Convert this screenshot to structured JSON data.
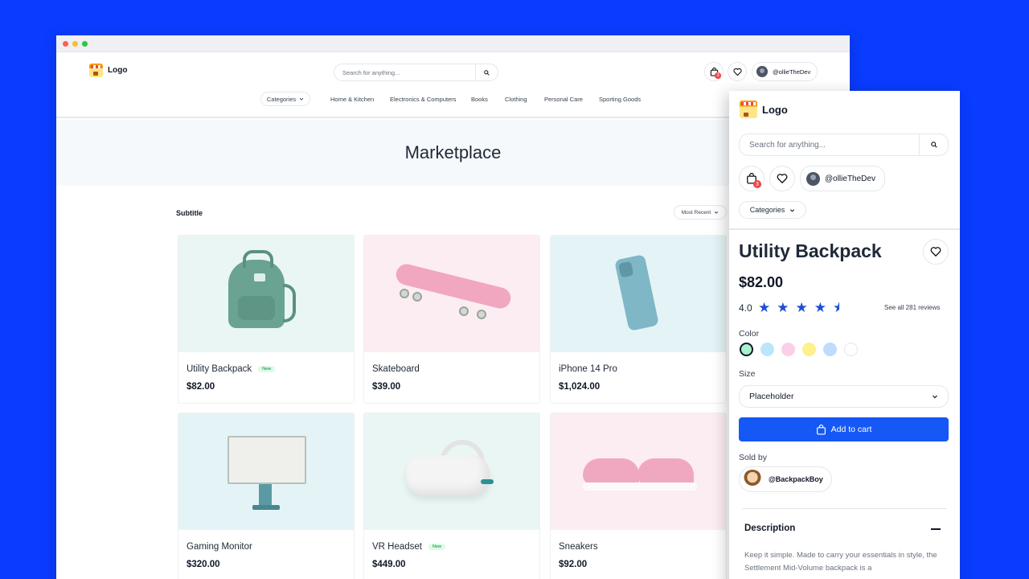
{
  "desktop": {
    "logo_text": "Logo",
    "search_placeholder": "Search for anything...",
    "cart_count": "3",
    "username": "@ollieTheDev",
    "nav": {
      "categories_label": "Categories",
      "links": [
        "Home & Kitchen",
        "Electronics & Computers",
        "Books",
        "Clothing",
        "Personal Care",
        "Sporting Goods"
      ]
    },
    "hero_title": "Marketplace",
    "subtitle": "Subtitle",
    "sort_label": "Most Recent",
    "products": [
      {
        "name": "Utility Backpack",
        "price": "$82.00",
        "badge": "New"
      },
      {
        "name": "Skateboard",
        "price": "$39.00"
      },
      {
        "name": "iPhone 14 Pro",
        "price": "$1,024.00"
      },
      {
        "name": "Gaming Monitor",
        "price": "$320.00"
      },
      {
        "name": "VR Headset",
        "price": "$449.00",
        "badge": "New"
      },
      {
        "name": "Sneakers",
        "price": "$92.00"
      }
    ]
  },
  "mobile": {
    "logo_text": "Logo",
    "search_placeholder": "Search for anything...",
    "cart_count": "3",
    "username": "@ollieTheDev",
    "categories_label": "Categories",
    "product_title": "Utility Backpack",
    "price": "$82.00",
    "rating": "4.0",
    "reviews_link": "See all 281 reviews",
    "color_label": "Color",
    "colors": [
      "#a7f3d0",
      "#bae6fd",
      "#fbcfe8",
      "#fef08a",
      "#bfdbfe",
      "#ffffff"
    ],
    "size_label": "Size",
    "size_value": "Placeholder",
    "add_to_cart": "Add to cart",
    "sold_by_label": "Sold by",
    "seller": "@BackpackBoy",
    "description_title": "Description",
    "description_text": "Keep it simple. Made to carry your essentials in style, the Settlement Mid-Volume backpack is a"
  },
  "colors": {
    "accent": "#1558f5",
    "background": "#0a3cff",
    "star": "#1d4ed8",
    "badge": "#ef4444"
  }
}
